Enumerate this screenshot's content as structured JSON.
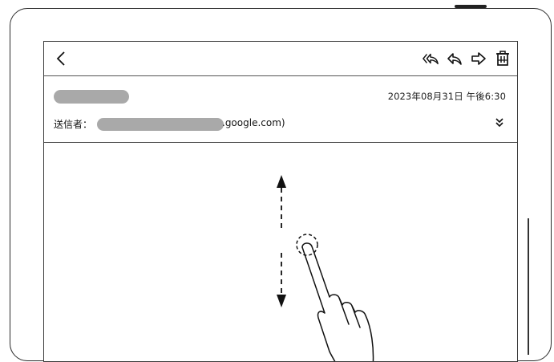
{
  "toolbar": {
    "back": "chevron-left-icon",
    "actions": [
      "reply-all-icon",
      "reply-icon",
      "forward-icon",
      "trash-icon"
    ]
  },
  "message": {
    "date": "2023年08月31日 午後6:30",
    "sender_label": "送信者：",
    "sender_suffix": ".google.com)"
  },
  "colors": {
    "frame": "#2a2a2a",
    "redaction": "#a9a9a9",
    "divider": "#555555"
  }
}
